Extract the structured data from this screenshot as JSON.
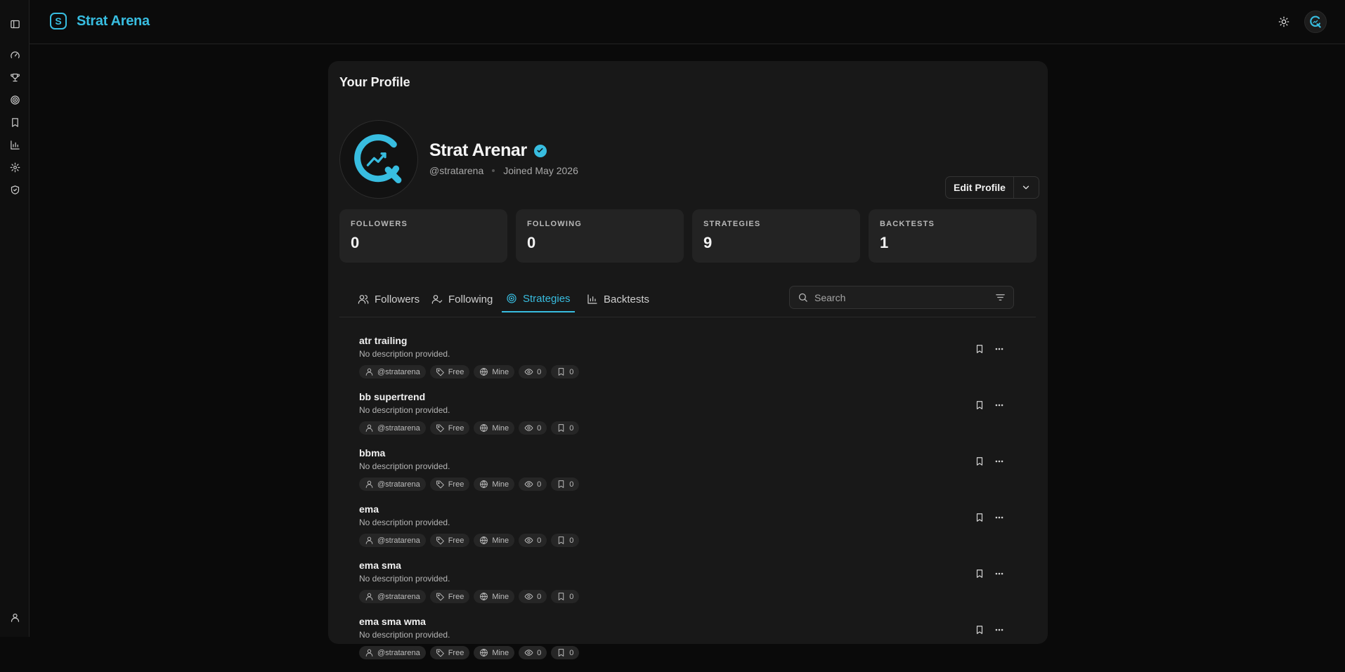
{
  "app": {
    "name": "Strat Arena",
    "logo_letter": "S"
  },
  "sidebar": {
    "items": [
      {
        "name": "toggle-sidebar-icon"
      },
      {
        "name": "gauge-icon"
      },
      {
        "name": "trophy-icon"
      },
      {
        "name": "target-icon"
      },
      {
        "name": "bookmark-icon"
      },
      {
        "name": "chart-icon"
      },
      {
        "name": "gear-icon"
      },
      {
        "name": "shield-icon"
      },
      {
        "name": "user-icon"
      }
    ]
  },
  "header": {
    "theme_icon": "sun-icon",
    "avatar_icon": "logo-avatar-icon"
  },
  "page": {
    "title": "Your Profile"
  },
  "profile": {
    "name": "Strat Arenar",
    "handle": "@stratarena",
    "joined": "Joined May 2026",
    "edit_label": "Edit Profile",
    "accent": "#38bde0"
  },
  "stats": [
    {
      "label": "FOLLOWERS",
      "value": "0"
    },
    {
      "label": "FOLLOWING",
      "value": "0"
    },
    {
      "label": "STRATEGIES",
      "value": "9"
    },
    {
      "label": "BACKTESTS",
      "value": "1"
    }
  ],
  "tabs": [
    {
      "label": "Followers",
      "icon": "users-icon",
      "active": false
    },
    {
      "label": "Following",
      "icon": "user-check-icon",
      "active": false
    },
    {
      "label": "Strategies",
      "icon": "target-icon",
      "active": true
    },
    {
      "label": "Backtests",
      "icon": "chart-icon",
      "active": false
    }
  ],
  "search": {
    "placeholder": "Search",
    "value": ""
  },
  "strategies": [
    {
      "title": "atr trailing",
      "desc": "No description provided.",
      "author": "@stratarena",
      "price": "Free",
      "visibility": "Mine",
      "views": "0",
      "saves": "0"
    },
    {
      "title": "bb supertrend",
      "desc": "No description provided.",
      "author": "@stratarena",
      "price": "Free",
      "visibility": "Mine",
      "views": "0",
      "saves": "0"
    },
    {
      "title": "bbma",
      "desc": "No description provided.",
      "author": "@stratarena",
      "price": "Free",
      "visibility": "Mine",
      "views": "0",
      "saves": "0"
    },
    {
      "title": "ema",
      "desc": "No description provided.",
      "author": "@stratarena",
      "price": "Free",
      "visibility": "Mine",
      "views": "0",
      "saves": "0"
    },
    {
      "title": "ema sma",
      "desc": "No description provided.",
      "author": "@stratarena",
      "price": "Free",
      "visibility": "Mine",
      "views": "0",
      "saves": "0"
    },
    {
      "title": "ema sma wma",
      "desc": "No description provided.",
      "author": "@stratarena",
      "price": "Free",
      "visibility": "Mine",
      "views": "0",
      "saves": "0"
    }
  ]
}
